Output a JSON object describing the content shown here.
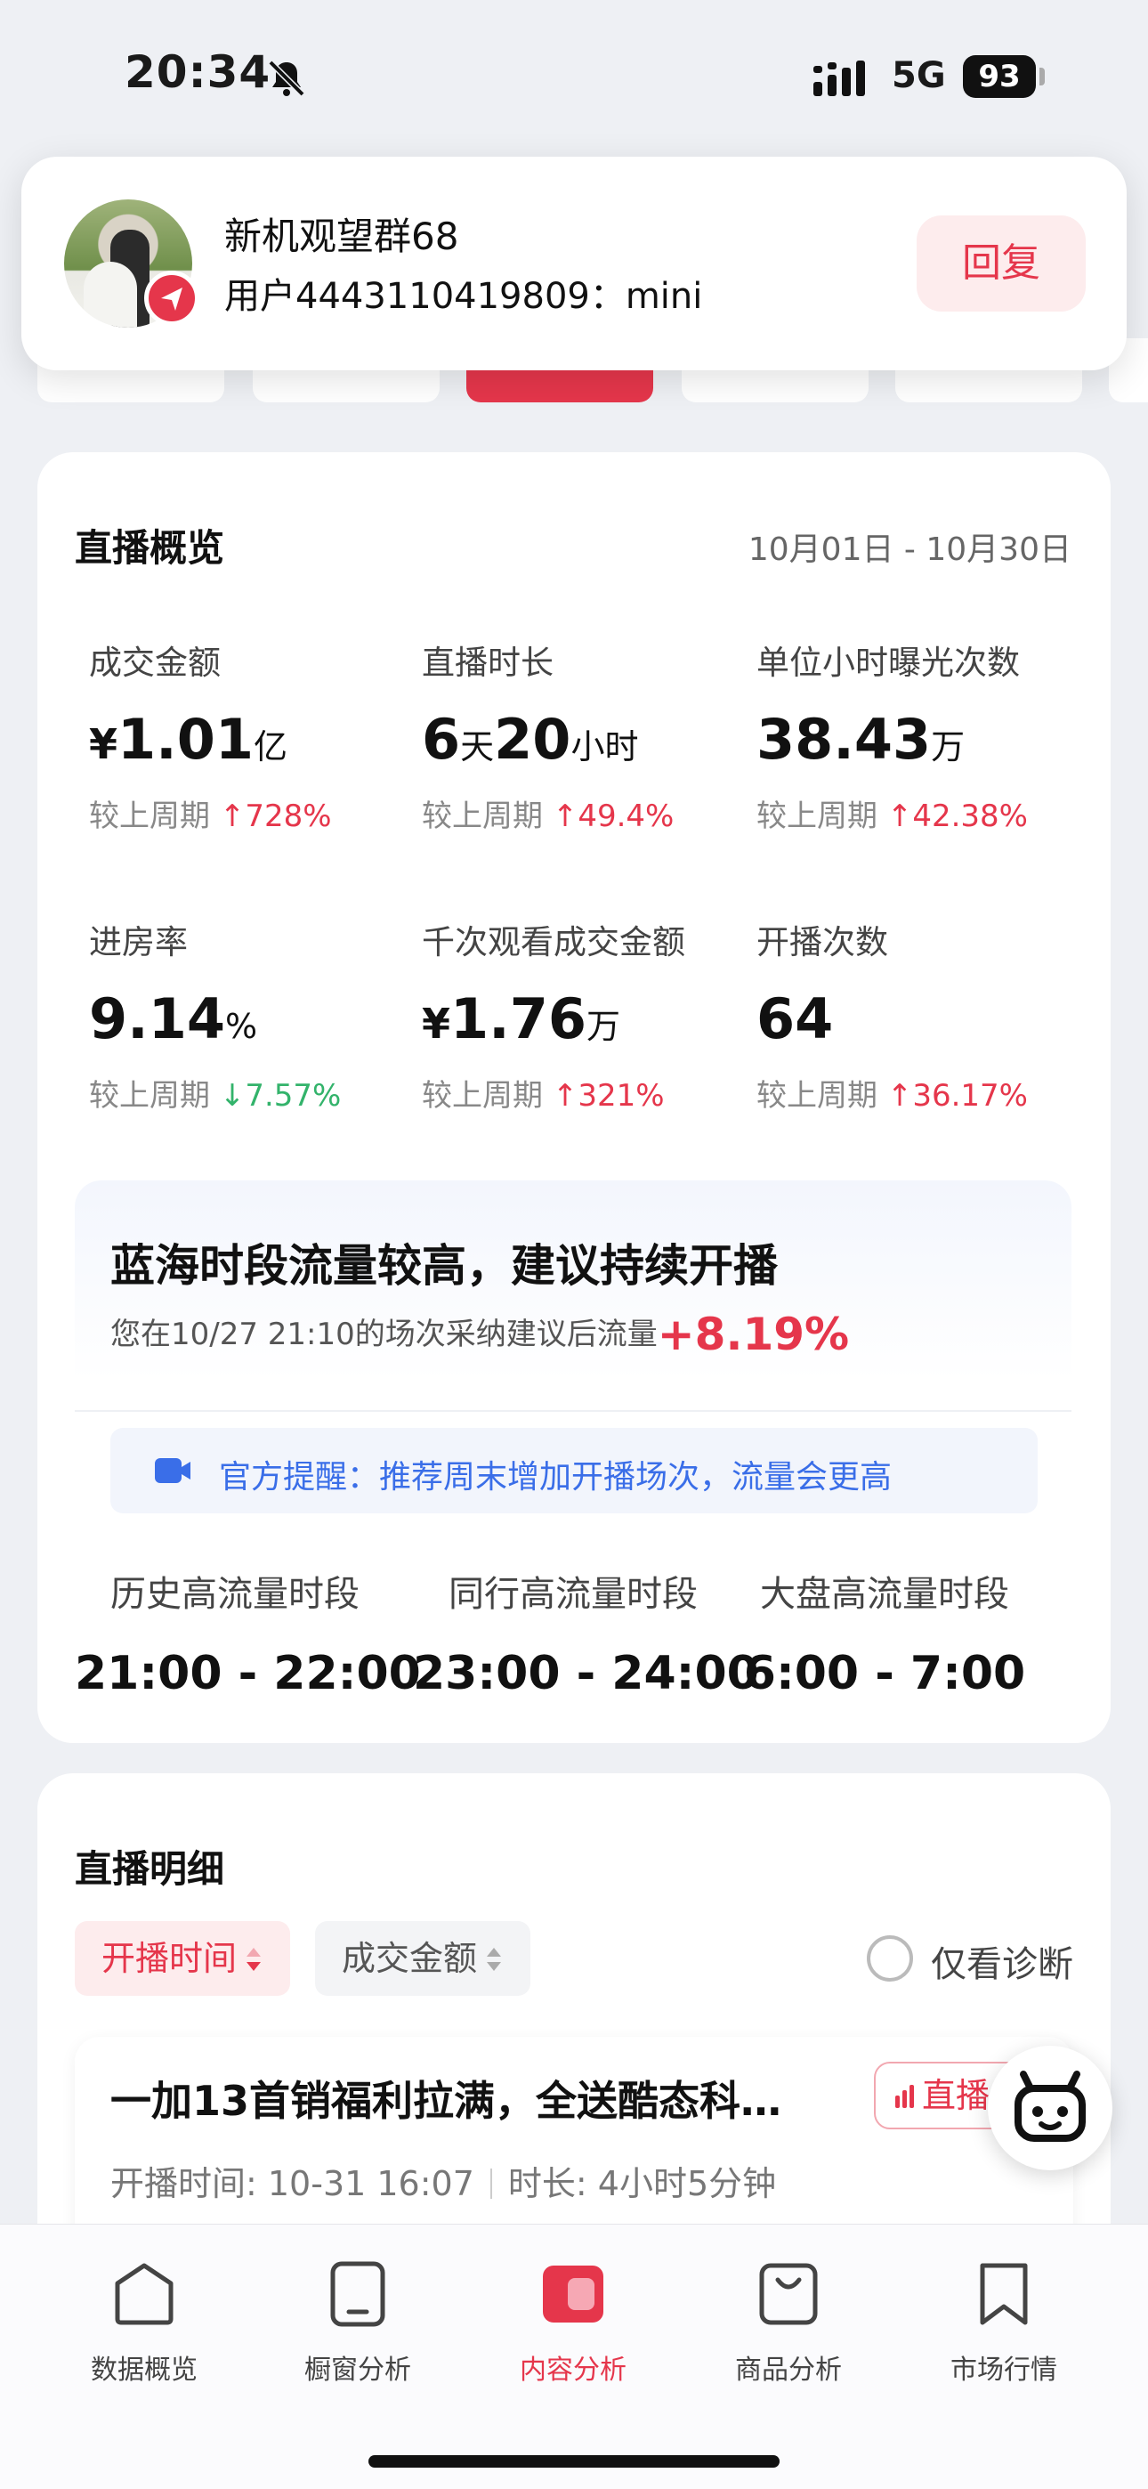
{
  "status_bar": {
    "time": "20:34",
    "network": "5G",
    "battery": "93"
  },
  "notification": {
    "title": "新机观望群68",
    "message": "用户4443110419809：mini",
    "reply_label": "回复"
  },
  "overview": {
    "title": "直播概览",
    "date_range": "10月01日 - 10月30日",
    "compare_prefix": "较上周期",
    "metrics": [
      {
        "label": "成交金额",
        "prefix": "¥",
        "value": "1.01",
        "unit": "亿",
        "change": "728%",
        "direction": "up"
      },
      {
        "label": "直播时长",
        "prefix": "",
        "value": "6",
        "unit": "天",
        "value2": "20",
        "unit2": "小时",
        "change": "49.4%",
        "direction": "up"
      },
      {
        "label": "单位小时曝光次数",
        "prefix": "",
        "value": "38.43",
        "unit": "万",
        "change": "42.38%",
        "direction": "up"
      },
      {
        "label": "进房率",
        "prefix": "",
        "value": "9.14",
        "unit": "%",
        "change": "7.57%",
        "direction": "down"
      },
      {
        "label": "千次观看成交金额",
        "prefix": "¥",
        "value": "1.76",
        "unit": "万",
        "change": "321%",
        "direction": "up"
      },
      {
        "label": "开播次数",
        "prefix": "",
        "value": "64",
        "unit": "",
        "change": "36.17%",
        "direction": "up"
      }
    ],
    "suggestion": {
      "title": "蓝海时段流量较高，建议持续开播",
      "subtitle": "您在10/27 21:10的场次采纳建议后流量",
      "subtitle_pct": "+8.19%",
      "tip": "官方提醒：推荐周末增加开播场次，流量会更高",
      "slots": [
        {
          "label": "历史高流量时段",
          "value": "21:00 - 22:00"
        },
        {
          "label": "同行高流量时段",
          "value": "23:00 - 24:00"
        },
        {
          "label": "大盘高流量时段",
          "value": "6:00 - 7:00"
        }
      ]
    }
  },
  "detail": {
    "title": "直播明细",
    "filters": {
      "active": "开播时间",
      "secondary": "成交金额"
    },
    "diagnose_label": "仅看诊断",
    "item": {
      "title": "一加13首销福利拉满，全送酷态科…",
      "badge": "直播大屏",
      "start_label": "开播时间: 10-31 16:07",
      "duration_label": "时长: 4小时5分钟"
    }
  },
  "bottom_nav": [
    {
      "label": "数据概览",
      "icon": "home-icon",
      "active": false
    },
    {
      "label": "橱窗分析",
      "icon": "phone-icon",
      "active": false
    },
    {
      "label": "内容分析",
      "icon": "video-icon",
      "active": true
    },
    {
      "label": "商品分析",
      "icon": "bag-icon",
      "active": false
    },
    {
      "label": "市场行情",
      "icon": "bookmark-icon",
      "active": false
    }
  ],
  "colors": {
    "accent": "#e5364b",
    "positive": "#33b36b",
    "tip_blue": "#3a6ee8"
  }
}
